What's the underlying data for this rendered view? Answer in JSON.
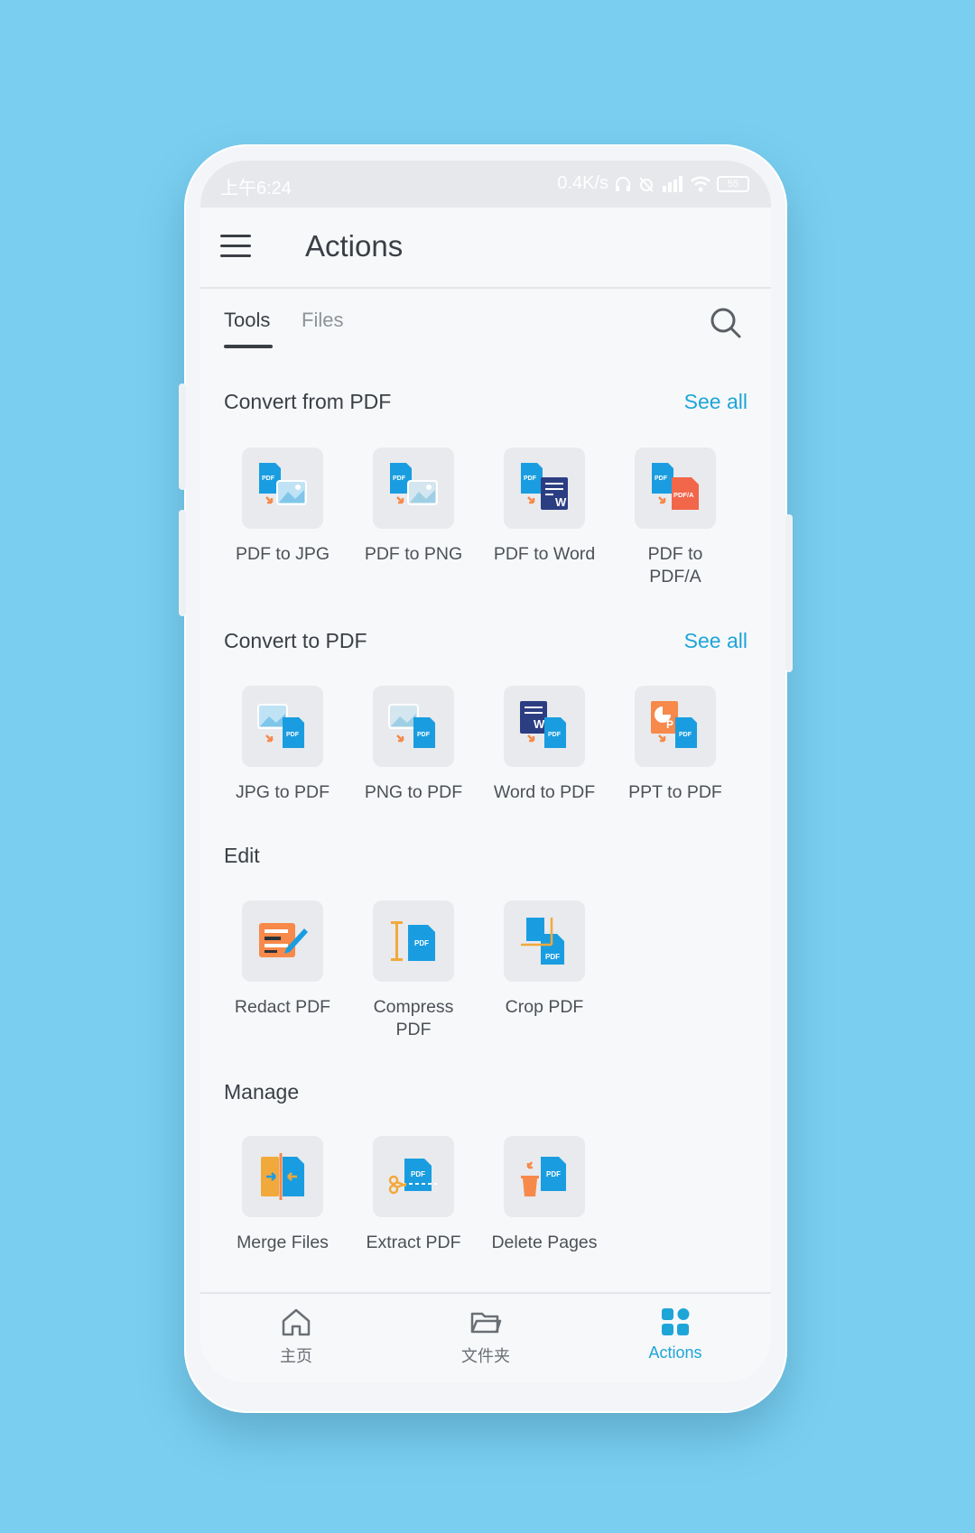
{
  "status": {
    "time": "上午6:24",
    "speed": "0.4K/s",
    "battery": "55"
  },
  "appbar": {
    "title": "Actions"
  },
  "tabs": [
    {
      "label": "Tools"
    },
    {
      "label": "Files"
    }
  ],
  "sections": {
    "convert_from": {
      "title": "Convert from PDF",
      "see_all": "See all"
    },
    "convert_to": {
      "title": "Convert to PDF",
      "see_all": "See all"
    },
    "edit": {
      "title": "Edit"
    },
    "manage": {
      "title": "Manage"
    }
  },
  "tools": {
    "pdf_to_jpg": "PDF to JPG",
    "pdf_to_png": "PDF to PNG",
    "pdf_to_word": "PDF to Word",
    "pdf_to_pdfa": "PDF to\nPDF/A",
    "jpg_to_pdf": "JPG to PDF",
    "png_to_pdf": "PNG to PDF",
    "word_to_pdf": "Word to PDF",
    "ppt_to_pdf": "PPT to PDF",
    "redact_pdf": "Redact PDF",
    "compress_pdf": "Compress\nPDF",
    "crop_pdf": "Crop PDF",
    "merge_files": "Merge Files",
    "extract_pdf": "Extract PDF",
    "delete_pages": "Delete Pages"
  },
  "icon_text": {
    "pdf": "PDF",
    "pdfa": "PDF/A",
    "w": "W",
    "p": "P"
  },
  "bottomnav": [
    {
      "label": "主页",
      "icon": "home-icon"
    },
    {
      "label": "文件夹",
      "icon": "folder-icon"
    },
    {
      "label": "Actions",
      "icon": "actions-grid-icon"
    }
  ],
  "colors": {
    "accent": "#1ea5d8",
    "background": "#7acff0",
    "text": "#3a3f45",
    "pdf_blue": "#1a9de0",
    "word_navy": "#2c3e82",
    "orange": "#f7894a"
  }
}
